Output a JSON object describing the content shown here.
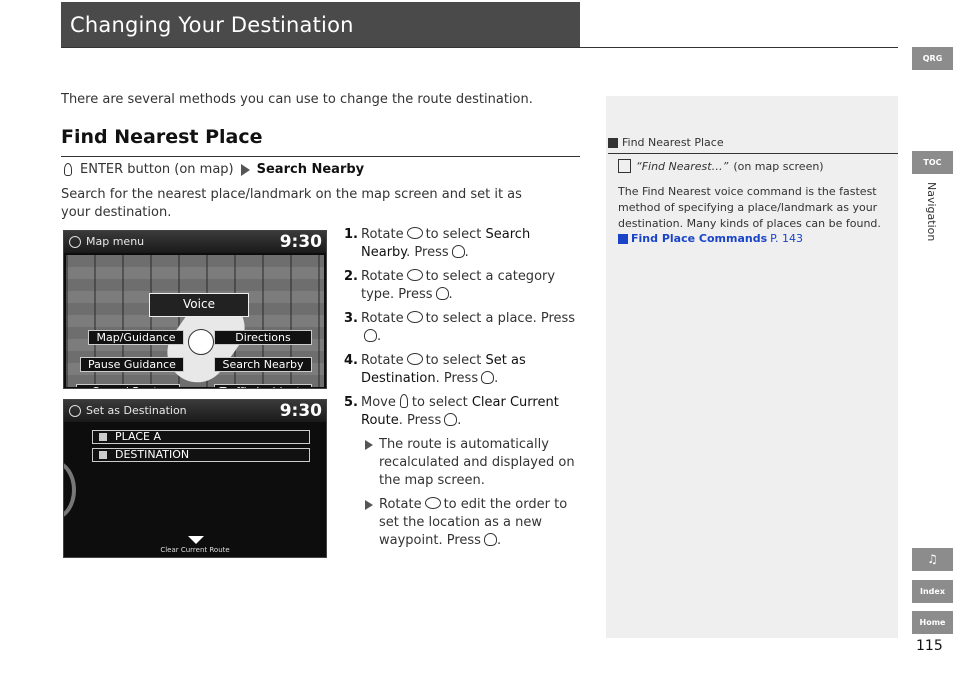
{
  "header": {
    "title": "Changing Your Destination"
  },
  "intro": "There are several methods you can use to change the route destination.",
  "section": {
    "title": "Find Nearest Place",
    "path_prefix": "ENTER button (on map)",
    "path_target": "Search Nearby",
    "description": "Search for the nearest place/landmark on the map screen and set it as your destination."
  },
  "screen1": {
    "title": "Map menu",
    "clock": "9:30",
    "voice": "Voice",
    "items": [
      "Map/Guidance",
      "Directions",
      "Pause Guidance",
      "Search Nearby",
      "Cancel Route",
      "Traffic Incidents"
    ]
  },
  "screen2": {
    "title": "Set as Destination",
    "clock": "9:30",
    "rows": [
      "PLACE A",
      "DESTINATION"
    ],
    "footer": "Clear Current Route"
  },
  "steps": [
    {
      "num": "1.",
      "a": "Rotate",
      "b": "to select",
      "c": "Search Nearby",
      "d": ". Press"
    },
    {
      "num": "2.",
      "a": "Rotate",
      "b": "to select a category type. Press"
    },
    {
      "num": "3.",
      "a": "Rotate",
      "b": "to select a place. Press"
    },
    {
      "num": "4.",
      "a": "Rotate",
      "b": "to select",
      "c": "Set as Destination",
      "d": ". Press"
    },
    {
      "num": "5.",
      "a": "Move",
      "b": "to select",
      "c": "Clear Current Route",
      "d": ". Press"
    }
  ],
  "sub_notes": [
    "The route is automatically recalculated and displayed on the map screen.",
    {
      "a": "Rotate",
      "b": "to edit the order to set the location as a new waypoint. Press"
    }
  ],
  "note": {
    "heading": "Find Nearest Place",
    "command": "“Find Nearest…”",
    "command_suffix": "(on map screen)",
    "body": "The Find Nearest voice command is the fastest method of specifying a place/landmark as your destination. Many kinds of places can be found.",
    "link_label": "Find Place Commands",
    "link_page": "P. 143"
  },
  "tabs": {
    "qrg": "QRG",
    "toc": "TOC",
    "index": "Index",
    "home": "Home",
    "side_label": "Navigation"
  },
  "page_number": "115"
}
